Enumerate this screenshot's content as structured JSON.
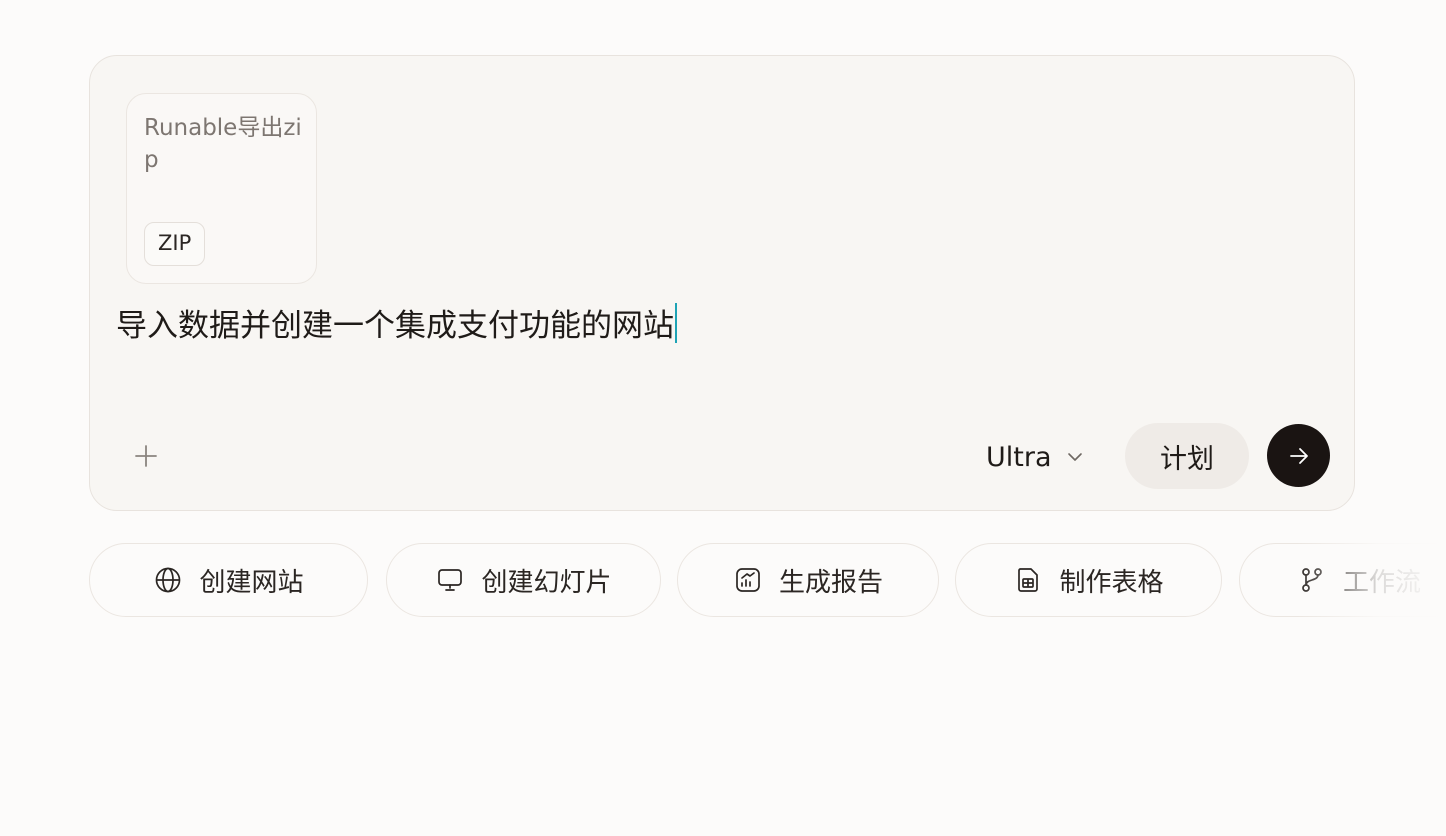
{
  "composer": {
    "attachment": {
      "name": "Runable导出zip",
      "type_badge": "ZIP"
    },
    "prompt_text": "导入数据并创建一个集成支付功能的网站",
    "model": "Ultra",
    "plan_label": "计划",
    "icons": {
      "add": "plus-icon",
      "model_dropdown": "chevron-down-icon",
      "send": "arrow-right-icon"
    }
  },
  "quick_actions": [
    {
      "label": "创建网站",
      "icon": "globe-icon"
    },
    {
      "label": "创建幻灯片",
      "icon": "presentation-icon"
    },
    {
      "label": "生成报告",
      "icon": "chart-report-icon"
    },
    {
      "label": "制作表格",
      "icon": "spreadsheet-icon"
    },
    {
      "label": "工作流",
      "icon": "git-branch-icon"
    }
  ],
  "colors": {
    "page_background": "#fcfbfa",
    "composer_background": "#f8f6f3",
    "send_button": "#1a1412",
    "caret": "#1ea3b5"
  }
}
